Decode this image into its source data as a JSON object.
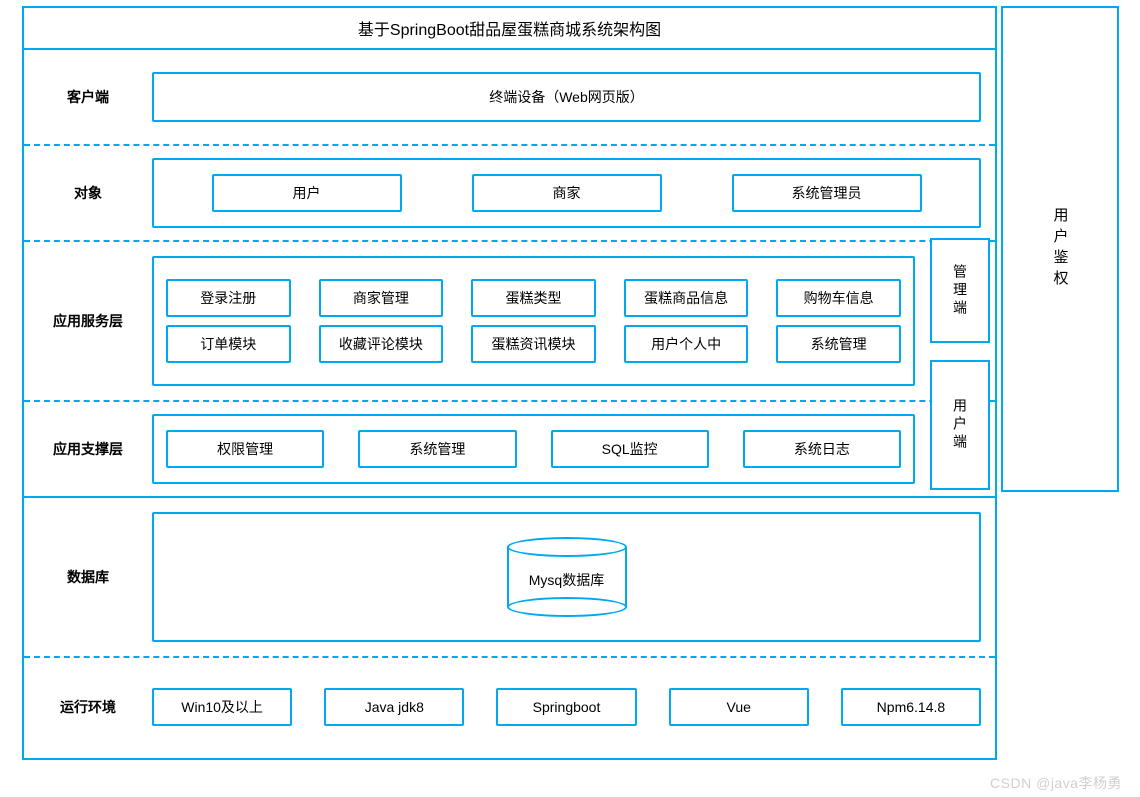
{
  "title": "基于SpringBoot甜品屋蛋糕商城系统架构图",
  "rows": {
    "client": {
      "label": "客户端",
      "box": "终端设备（Web网页版）"
    },
    "object": {
      "label": "对象",
      "items": [
        "用户",
        "商家",
        "系统管理员"
      ]
    },
    "service": {
      "label": "应用服务层",
      "row1": [
        "登录注册",
        "商家管理",
        "蛋糕类型",
        "蛋糕商品信息",
        "购物车信息"
      ],
      "row2": [
        "订单模块",
        "收藏评论模块",
        "蛋糕资讯模块",
        "用户个人中",
        "系统管理"
      ]
    },
    "support": {
      "label": "应用支撑层",
      "items": [
        "权限管理",
        "系统管理",
        "SQL监控",
        "系统日志"
      ]
    },
    "db": {
      "label": "数据库",
      "cylinder": "Mysq数据库"
    },
    "env": {
      "label": "运行环境",
      "items": [
        "Win10及以上",
        "Java jdk8",
        "Springboot",
        "Vue",
        "Npm6.14.8"
      ]
    }
  },
  "right": {
    "auth": "用户鉴权",
    "mgmt": "管理端",
    "user": "用户端"
  },
  "watermark": "CSDN @java李杨勇"
}
